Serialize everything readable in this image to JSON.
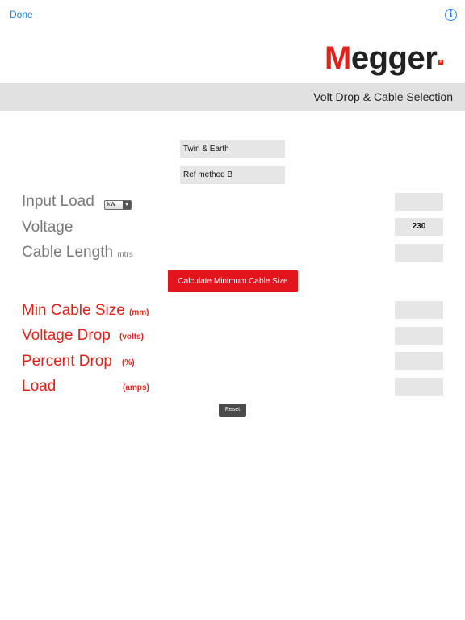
{
  "toolbar": {
    "done_label": "Done",
    "info_glyph": "i"
  },
  "logo": {
    "first_letter": "M",
    "rest": "egger",
    "reg_mark": "R"
  },
  "header": {
    "title": "Volt Drop & Cable Selection"
  },
  "selections": {
    "cable_type": "Twin & Earth",
    "reference_method": "Ref method B"
  },
  "inputs": {
    "input_load": {
      "label": "Input Load",
      "unit_selected": "kW",
      "value": ""
    },
    "voltage": {
      "label": "Voltage",
      "value": "230"
    },
    "cable_length": {
      "label": "Cable Length",
      "unit": "mtrs",
      "value": ""
    }
  },
  "calculate_label": "Calculate Minimum Cable Size",
  "results": {
    "min_cable_size": {
      "label": "Min Cable Size",
      "unit": "(mm)",
      "value": ""
    },
    "voltage_drop": {
      "label": "Voltage Drop",
      "unit": "(volts)",
      "value": ""
    },
    "percent_drop": {
      "label": "Percent Drop",
      "unit": "(%)",
      "value": ""
    },
    "load": {
      "label": "Load",
      "unit": "(amps)",
      "value": ""
    }
  },
  "reset_label": "Reset",
  "colors": {
    "accent_blue": "#1a7ff0",
    "brand_red": "#e3211b",
    "band_grey": "#e1e1e1",
    "field_grey": "#e6e6e6",
    "label_grey": "#7a7a7a"
  },
  "icons": {
    "info": "info-icon",
    "dropdown": "chevron-down-icon"
  }
}
